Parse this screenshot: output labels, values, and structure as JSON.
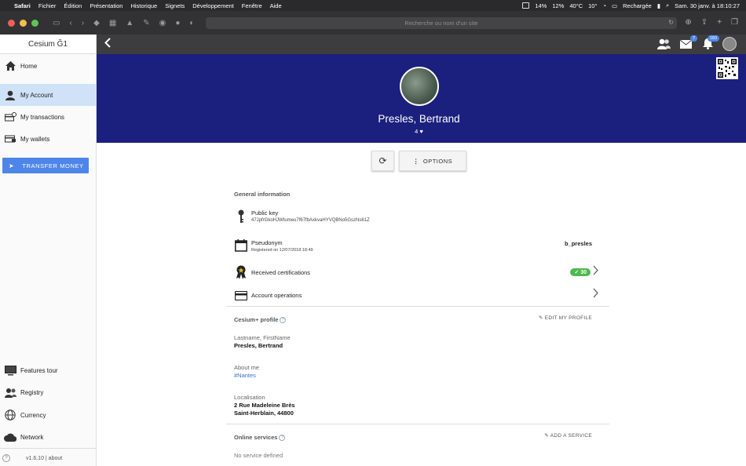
{
  "menubar": {
    "items": [
      "Safari",
      "Fichier",
      "Édition",
      "Présentation",
      "Historique",
      "Signets",
      "Développement",
      "Fenêtre",
      "Aide"
    ],
    "status": {
      "cpu1": "14%",
      "cpu2": "12%",
      "temp": "40°C",
      "weather": "10°",
      "battery": "Rechargée",
      "datetime": "Sam. 30 janv. à 18:10:27",
      "calendar_day": "30"
    }
  },
  "browser": {
    "url_placeholder": "Recherche ou nom d'un site"
  },
  "sidebar": {
    "title": "Cesium Ğ1",
    "items": [
      {
        "label": "Home",
        "icon": "home-icon"
      },
      {
        "label": "My Account",
        "icon": "person-icon"
      },
      {
        "label": "My transactions",
        "icon": "card-clock-icon"
      },
      {
        "label": "My wallets",
        "icon": "wallet-icon"
      }
    ],
    "transfer_label": "TRANSFER MONEY",
    "bottom_items": [
      {
        "label": "Features tour",
        "icon": "tv-icon"
      },
      {
        "label": "Registry",
        "icon": "people-icon"
      },
      {
        "label": "Currency",
        "icon": "globe-icon"
      },
      {
        "label": "Network",
        "icon": "cloud-icon"
      }
    ],
    "version": "v1.6.10 | about"
  },
  "header": {
    "messages_badge": "7",
    "notifications_badge": "183"
  },
  "profile": {
    "name": "Presles, Bertrand",
    "likes": "4",
    "options_label": "OPTIONS"
  },
  "general": {
    "title": "General information",
    "public_key_label": "Public key",
    "public_key": "47JpfrGkoHJWtumeu7f67fbAxkvaHYVQBNo5GszNs61Z",
    "pseudonym_label": "Pseudonym",
    "registered": "Registered on 12/07/2018 18:49",
    "pseudonym": "b_presles",
    "certifications_label": "Received certifications",
    "certifications_count": "30",
    "operations_label": "Account operations"
  },
  "cesium_profile": {
    "title": "Cesium+ profile",
    "edit_label": "EDIT MY PROFILE",
    "name_label": "Lastname, FirstName",
    "name_value": "Presles, Bertrand",
    "about_label": "About me",
    "about_value": "#Nantes",
    "location_label": "Localisation",
    "location_line1": "2 Rue Madeleine Brès",
    "location_line2": "Saint-Herblain, 44800"
  },
  "services": {
    "title": "Online services",
    "add_label": "ADD A SERVICE",
    "empty": "No service defined"
  },
  "colors": {
    "banner": "#1b1f7e",
    "accent": "#4e85e8",
    "cert_green": "#4fb851",
    "active_item": "#cfe2f7"
  }
}
